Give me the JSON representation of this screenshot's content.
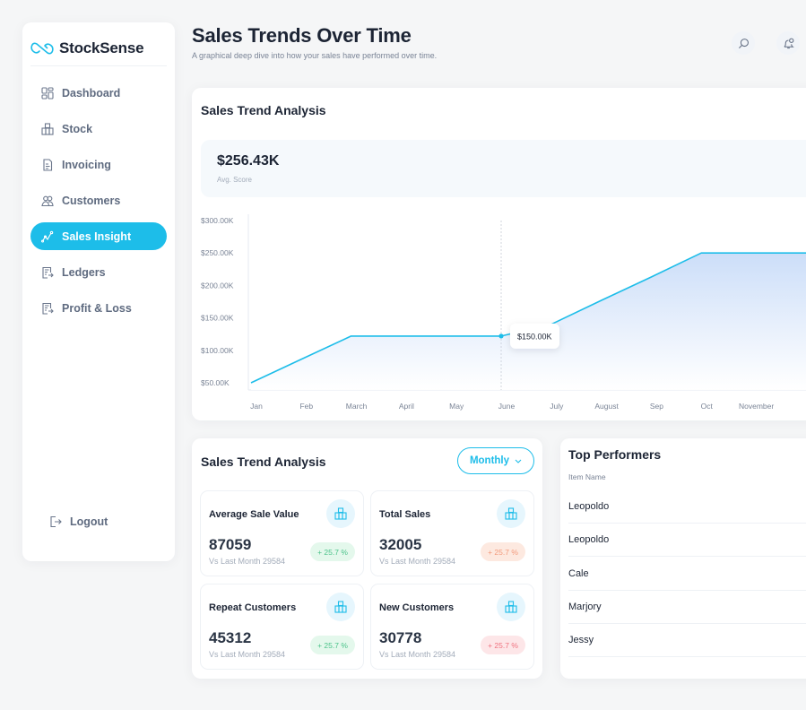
{
  "brand": {
    "name": "StockSense",
    "logo_icon": "infinity-link-icon"
  },
  "sidebar": {
    "items": [
      {
        "label": "Dashboard",
        "icon": "grid-icon",
        "active": false
      },
      {
        "label": "Stock",
        "icon": "boxes-icon",
        "active": false
      },
      {
        "label": "Invoicing",
        "icon": "document-icon",
        "active": false
      },
      {
        "label": "Customers",
        "icon": "users-icon",
        "active": false
      },
      {
        "label": "Sales Insight",
        "icon": "trend-icon",
        "active": true
      },
      {
        "label": "Ledgers",
        "icon": "ledger-icon",
        "active": false
      },
      {
        "label": "Profit & Loss",
        "icon": "report-icon",
        "active": false
      }
    ],
    "logout_label": "Logout"
  },
  "header": {
    "title": "Sales Trends Over Time",
    "subtitle": "A graphical deep dive into how your sales have performed over time.",
    "icons": [
      "search-icon",
      "notification-bell-icon"
    ]
  },
  "colors": {
    "accent": "#1dbde9",
    "text": "#1c2434",
    "muted": "#7a8496"
  },
  "trend_card": {
    "title": "Sales Trend Analysis",
    "summary_value": "$256.43K",
    "summary_label": "Avg. Score",
    "tooltip": "$150.00K"
  },
  "chart_data": {
    "type": "area",
    "title": "Sales Trend Analysis",
    "xlabel": "",
    "ylabel": "",
    "categories": [
      "Jan",
      "Feb",
      "March",
      "April",
      "May",
      "June",
      "July",
      "August",
      "Sep",
      "Oct",
      "November"
    ],
    "series": [
      {
        "name": "Sales",
        "values": [
          50000,
          86000,
          122000,
          122000,
          122000,
          122000,
          140000,
          177000,
          213000,
          250000,
          250000
        ]
      }
    ],
    "y_ticks": [
      "$50.00K",
      "$100.00K",
      "$150.00K",
      "$200.00K",
      "$250.00K",
      "$300.00K"
    ],
    "ylim": [
      50000,
      300000
    ],
    "highlight_index": 5,
    "grid": false,
    "legend": "none"
  },
  "kpi_section": {
    "title": "Sales Trend Analysis",
    "period_select": "Monthly",
    "cards": [
      {
        "label": "Average Sale Value",
        "value": "87059",
        "vs": "Vs Last Month 29584",
        "change": "+ 25.7 %",
        "tone": "green"
      },
      {
        "label": "Total Sales",
        "value": "32005",
        "vs": "Vs Last Month 29584",
        "change": "+ 25.7 %",
        "tone": "orange"
      },
      {
        "label": "Repeat Customers",
        "value": "45312",
        "vs": "Vs Last Month 29584",
        "change": "+ 25.7 %",
        "tone": "green"
      },
      {
        "label": "New Customers",
        "value": "30778",
        "vs": "Vs Last Month 29584",
        "change": "+ 25.7 %",
        "tone": "red"
      }
    ]
  },
  "top_performers": {
    "title": "Top Performers",
    "column": "Item Name",
    "rows": [
      "Leopoldo",
      "Leopoldo",
      "Cale",
      "Marjory",
      "Jessy"
    ]
  }
}
